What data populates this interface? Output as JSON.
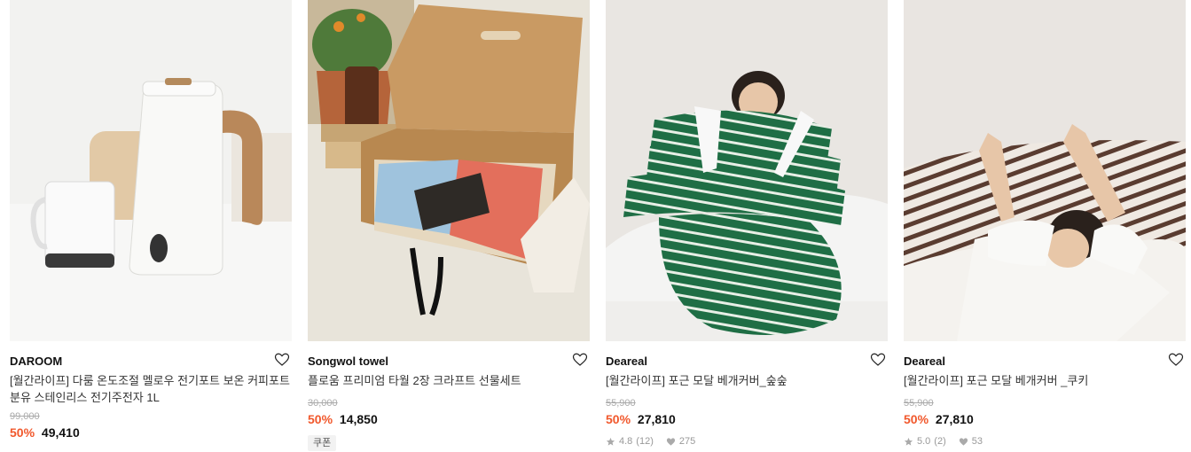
{
  "products": [
    {
      "brand": "DAROOM",
      "name_line1": "[월간라이프] 다룸 온도조절 멜로우 전기포트 보온 커피포트",
      "name_line2": "분유 스테인리스 전기주전자 1L",
      "original_price": "99,000",
      "discount": "50%",
      "price": "49,410",
      "image": "electric-kettle-photo"
    },
    {
      "brand": "Songwol towel",
      "name_line1": "플로움 프리미엄 타월 2장 크라프트 선물세트",
      "original_price": "30,000",
      "discount": "50%",
      "price": "14,850",
      "badge": "쿠폰",
      "image": "towel-gift-box-photo"
    },
    {
      "brand": "Deareal",
      "name_line1": "[월간라이프] 포근 모달 베개커버_숲숲",
      "original_price": "55,900",
      "discount": "50%",
      "price": "27,810",
      "rating": "4.8",
      "reviews": "(12)",
      "likes": "275",
      "image": "green-striped-pillows-photo"
    },
    {
      "brand": "Deareal",
      "name_line1": "[월간라이프] 포근 모달 베개커버 _쿠키",
      "original_price": "55,900",
      "discount": "50%",
      "price": "27,810",
      "rating": "5.0",
      "reviews": "(2)",
      "likes": "53",
      "image": "brown-striped-pillows-photo"
    }
  ],
  "colors": {
    "discount": "#f1582c",
    "strike": "#aaaaaa"
  }
}
